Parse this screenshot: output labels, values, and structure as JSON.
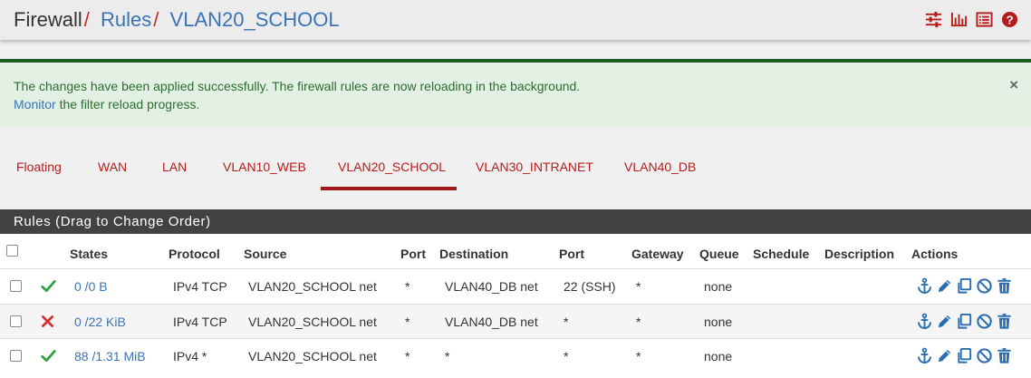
{
  "header": {
    "breadcrumb_root": "Firewall",
    "breadcrumb_sep": "/",
    "breadcrumb_rules": "Rules",
    "breadcrumb_current": "VLAN20_SCHOOL",
    "icons": [
      "settings-sliders-icon",
      "bar-chart-icon",
      "list-icon",
      "help-icon"
    ]
  },
  "alert": {
    "message": "The changes have been applied successfully. The firewall rules are now reloading in the background.",
    "monitor_link": "Monitor",
    "monitor_suffix": " the filter reload progress.",
    "close": "×"
  },
  "tabs": [
    {
      "label": "Floating"
    },
    {
      "label": "WAN"
    },
    {
      "label": "LAN"
    },
    {
      "label": "VLAN10_WEB"
    },
    {
      "label": "VLAN20_SCHOOL",
      "active": true
    },
    {
      "label": "VLAN30_INTRANET"
    },
    {
      "label": "VLAN40_DB"
    }
  ],
  "panel": {
    "title": "Rules (Drag to Change Order)"
  },
  "table": {
    "headers": {
      "states": "States",
      "protocol": "Protocol",
      "source": "Source",
      "port": "Port",
      "destination": "Destination",
      "dest_port": "Port",
      "gateway": "Gateway",
      "queue": "Queue",
      "schedule": "Schedule",
      "description": "Description",
      "actions": "Actions"
    },
    "rows": [
      {
        "status": "pass",
        "states": "0 /0 B",
        "protocol": "IPv4 TCP",
        "source": "VLAN20_SCHOOL net",
        "port": "*",
        "destination": "VLAN40_DB net",
        "dest_port": "22 (SSH)",
        "gateway": "*",
        "queue": "none",
        "schedule": "",
        "description": ""
      },
      {
        "status": "block",
        "states": "0 /22 KiB",
        "protocol": "IPv4 TCP",
        "source": "VLAN20_SCHOOL net",
        "port": "*",
        "destination": "VLAN40_DB net",
        "dest_port": "*",
        "gateway": "*",
        "queue": "none",
        "schedule": "",
        "description": ""
      },
      {
        "status": "pass",
        "states": "88 /1.31 MiB",
        "protocol": "IPv4 *",
        "source": "VLAN20_SCHOOL net",
        "port": "*",
        "destination": "*",
        "dest_port": "*",
        "gateway": "*",
        "queue": "none",
        "schedule": "",
        "description": ""
      }
    ]
  },
  "colors": {
    "accent_red": "#b71c1c",
    "link_blue": "#3a73b5",
    "pass_green": "#2e9e3e",
    "block_red": "#d32f2f",
    "action_blue": "#2a6eb0"
  }
}
